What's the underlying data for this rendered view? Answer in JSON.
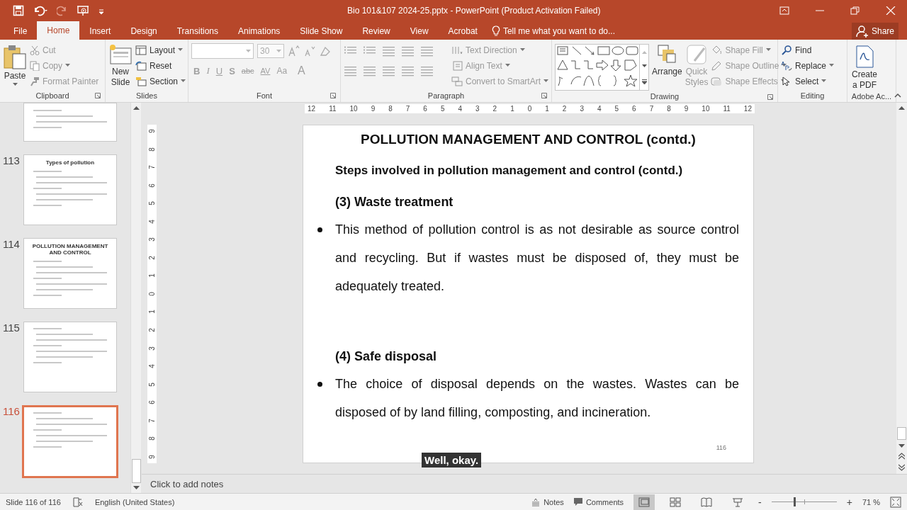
{
  "window": {
    "title": "Bio 101&107 2024-25.pptx - PowerPoint (Product Activation Failed)"
  },
  "menu_tabs": [
    {
      "label": "File",
      "selected": false
    },
    {
      "label": "Home",
      "selected": true
    },
    {
      "label": "Insert",
      "selected": false
    },
    {
      "label": "Design",
      "selected": false
    },
    {
      "label": "Transitions",
      "selected": false
    },
    {
      "label": "Animations",
      "selected": false
    },
    {
      "label": "Slide Show",
      "selected": false
    },
    {
      "label": "Review",
      "selected": false
    },
    {
      "label": "View",
      "selected": false
    },
    {
      "label": "Acrobat",
      "selected": false
    }
  ],
  "tell_me": {
    "placeholder": "Tell me what you want to do..."
  },
  "share_button": "Share",
  "ribbon": {
    "clipboard": {
      "label": "Clipboard",
      "paste": "Paste",
      "items": [
        {
          "label": "Cut",
          "disabled": true
        },
        {
          "label": "Copy",
          "disabled": true
        },
        {
          "label": "Format Painter",
          "disabled": true
        }
      ]
    },
    "slides": {
      "label": "Slides",
      "new_slide": "New Slide",
      "items": [
        {
          "label": "Layout",
          "disabled": false
        },
        {
          "label": "Reset",
          "disabled": false
        },
        {
          "label": "Section",
          "disabled": false
        }
      ]
    },
    "font": {
      "label": "Font",
      "size": "30",
      "buttons": [
        "B",
        "I",
        "U",
        "S",
        "abc",
        "AV",
        "Aa",
        "A"
      ]
    },
    "paragraph": {
      "label": "Paragraph",
      "items": [
        {
          "label": "Text Direction",
          "disabled": true
        },
        {
          "label": "Align Text",
          "disabled": true
        },
        {
          "label": "Convert to SmartArt",
          "disabled": true
        }
      ]
    },
    "drawing": {
      "label": "Drawing",
      "arrange": "Arrange",
      "quick_styles": "Quick Styles",
      "items": [
        {
          "label": "Shape Fill",
          "disabled": true
        },
        {
          "label": "Shape Outline",
          "disabled": true
        },
        {
          "label": "Shape Effects",
          "disabled": true
        }
      ]
    },
    "editing": {
      "label": "Editing",
      "items": [
        {
          "label": "Find",
          "disabled": false
        },
        {
          "label": "Replace",
          "disabled": false
        },
        {
          "label": "Select",
          "disabled": false
        }
      ]
    },
    "adobe": {
      "label": "Adobe Ac...",
      "create_pdf": "Create a PDF"
    }
  },
  "thumbnails": [
    {
      "kind": "partial",
      "selected": false
    },
    {
      "kind": "full",
      "number": "113",
      "title": "Types of pollution",
      "selected": false
    },
    {
      "kind": "full",
      "number": "114",
      "title": "POLLUTION MANAGEMENT AND CONTROL",
      "selected": false
    },
    {
      "kind": "full",
      "number": "115",
      "selected": false
    },
    {
      "kind": "full",
      "number": "116",
      "selected": true
    }
  ],
  "ruler": {
    "horizontal": [
      "12",
      "11",
      "10",
      "9",
      "8",
      "7",
      "6",
      "5",
      "4",
      "3",
      "2",
      "1",
      "0",
      "1",
      "2",
      "3",
      "4",
      "5",
      "6",
      "7",
      "8",
      "9",
      "10",
      "11",
      "12"
    ],
    "vertical": [
      "9",
      "8",
      "7",
      "6",
      "5",
      "4",
      "3",
      "2",
      "1",
      "0",
      "1",
      "2",
      "3",
      "4",
      "5",
      "6",
      "7",
      "8",
      "9"
    ]
  },
  "slide": {
    "title": "POLLUTION MANAGEMENT AND CONTROL (contd.)",
    "subtitle": "Steps involved in pollution management and control (contd.)",
    "sections": [
      {
        "heading": "(3) Waste treatment",
        "bullets": [
          "This method of pollution control is as not desirable as source control and recycling. But if wastes must be disposed of, they must be adequately treated."
        ]
      },
      {
        "heading": "(4) Safe disposal",
        "bullets": [
          "The choice of disposal depends on the wastes. Wastes can be disposed of by land filling, composting, and incineration."
        ]
      }
    ],
    "page_number": "116"
  },
  "caption": "Well, okay.",
  "notes": {
    "placeholder": "Click to add notes"
  },
  "status_bar": {
    "slide_info": "Slide 116 of 116",
    "language": "English (United States)",
    "notes": "Notes",
    "comments": "Comments",
    "views": [
      {
        "selected": true
      },
      {
        "selected": false
      },
      {
        "selected": false
      },
      {
        "selected": false
      }
    ],
    "zoom_minus": "-",
    "zoom_plus": "+",
    "zoom": {
      "level": 0.35
    },
    "zoom_percent": "71 %"
  }
}
